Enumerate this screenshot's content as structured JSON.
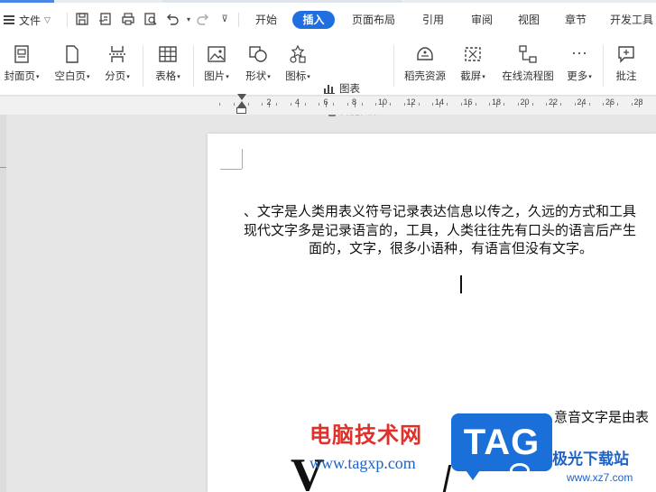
{
  "menu": {
    "file_label": "文件"
  },
  "tabs": [
    {
      "label": "开始"
    },
    {
      "label": "插入"
    },
    {
      "label": "页面布局"
    },
    {
      "label": "引用"
    },
    {
      "label": "审阅"
    },
    {
      "label": "视图"
    },
    {
      "label": "章节"
    },
    {
      "label": "开发工具"
    }
  ],
  "active_tab": "插入",
  "quick_access": [
    "save-icon",
    "export-pdf-icon",
    "print-icon",
    "print-preview-icon",
    "undo-icon",
    "redo-icon",
    "customize-icon"
  ],
  "ribbon": {
    "cover_page": "封面页",
    "blank_page": "空白页",
    "page_break": "分页",
    "table": "表格",
    "picture": "图片",
    "shape": "形状",
    "icon": "图标",
    "chart": "图表",
    "smart_art": "智能图形",
    "docer_resources": "稻壳资源",
    "screenshot": "截屏",
    "online_flowchart": "在线流程图",
    "more": "更多",
    "comment": "批注"
  },
  "ruler": {
    "labels": [
      "2",
      "4",
      "6",
      "8",
      "10",
      "12",
      "14",
      "16",
      "18",
      "20",
      "22",
      "24",
      "26",
      "28"
    ]
  },
  "document": {
    "line1": "、文字是人类用表义符号记录表达信息以传之，久远的方式和工具",
    "line2": "现代文字多是记录语言的，工具，人类往往先有口头的语言后产生",
    "line3": "面的，文字，很多小语种，有语言但没有文字。",
    "line4": "意音文字是由表"
  },
  "watermark": {
    "cn": "电脑技术网",
    "url": "www.tagxp.com",
    "tag": "TAG",
    "site": "极光下载站",
    "site_url": "www.xz7.com"
  },
  "colors": {
    "accent": "#1f6fe0",
    "wm_red": "#e0302a",
    "wm_blue": "#1e63c5"
  }
}
